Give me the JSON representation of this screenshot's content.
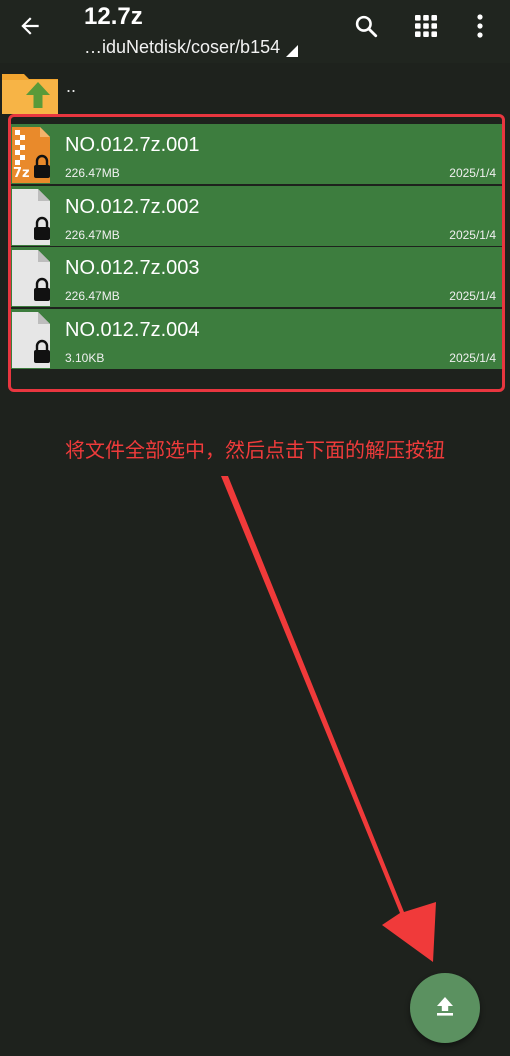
{
  "toolbar": {
    "title": "12.7z",
    "path": "…iduNetdisk/coser/b154",
    "icons": [
      "back-arrow-icon",
      "search-icon",
      "grid-view-icon",
      "more-vert-icon"
    ]
  },
  "parent": {
    "label": ".."
  },
  "files": [
    {
      "name": "NO.012.7z.001",
      "size": "226.47MB",
      "date": "2025/1/4",
      "icon": "7z-archive-locked-icon",
      "icon_text": "7z"
    },
    {
      "name": "NO.012.7z.002",
      "size": "226.47MB",
      "date": "2025/1/4",
      "icon": "locked-file-icon"
    },
    {
      "name": "NO.012.7z.003",
      "size": "226.47MB",
      "date": "2025/1/4",
      "icon": "locked-file-icon"
    },
    {
      "name": "NO.012.7z.004",
      "size": "3.10KB",
      "date": "2025/1/4",
      "icon": "locked-file-icon"
    }
  ],
  "annotation": {
    "text": "将文件全部选中，然后点击下面的解压按钮",
    "color": "#ef3b3b"
  },
  "fab": {
    "icon": "extract-upload-icon"
  },
  "colors": {
    "background": "#1e221d",
    "selection": "#3d7d3e",
    "fab": "#5b9160",
    "highlight": "#e8363f"
  }
}
